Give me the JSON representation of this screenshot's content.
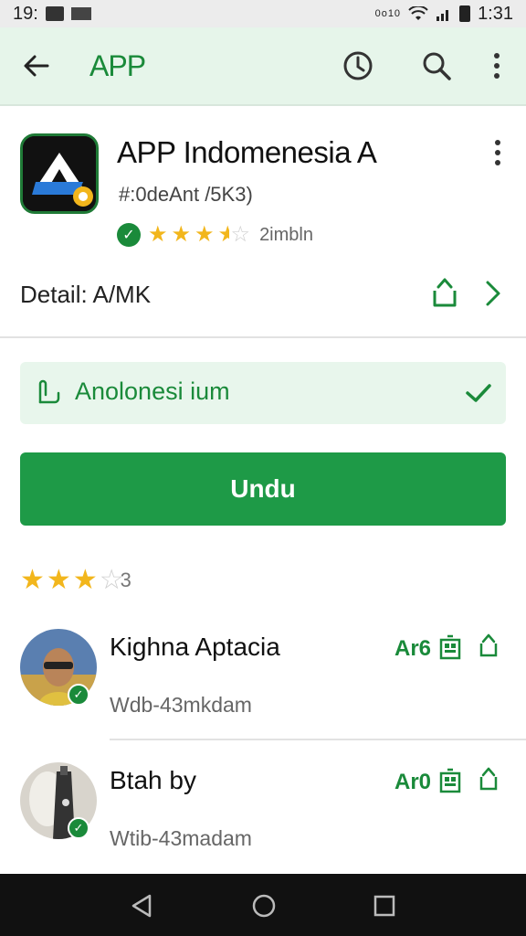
{
  "status_bar": {
    "left_text": "19:",
    "right_small": "0ᴏ10",
    "time": "1:31"
  },
  "app_bar": {
    "title": "APP",
    "icons": [
      "back-arrow-icon",
      "history-icon",
      "search-icon",
      "more-vert-icon"
    ]
  },
  "app": {
    "name": "APP Indomenesia  A",
    "subtitle": "#:0deAnt  /5K3)",
    "rating_stars": 3.5,
    "rating_count": "2imbln",
    "detail_label": "Detail: A/MK"
  },
  "selector": {
    "label": "Anolonesi ium"
  },
  "install_button": {
    "label": "Undu"
  },
  "overall_rating": {
    "stars": 3,
    "value": "3"
  },
  "reviews": [
    {
      "name": "Kighna Aptacia",
      "tag": "Ar6",
      "meta": "Wdb-43mkdam"
    },
    {
      "name": "Btah by",
      "tag": "Ar0",
      "meta": "Wtib-43madam"
    }
  ],
  "colors": {
    "accent": "#1e9a47",
    "appbar_bg": "#e6f5ea",
    "star": "#f2b61c"
  }
}
